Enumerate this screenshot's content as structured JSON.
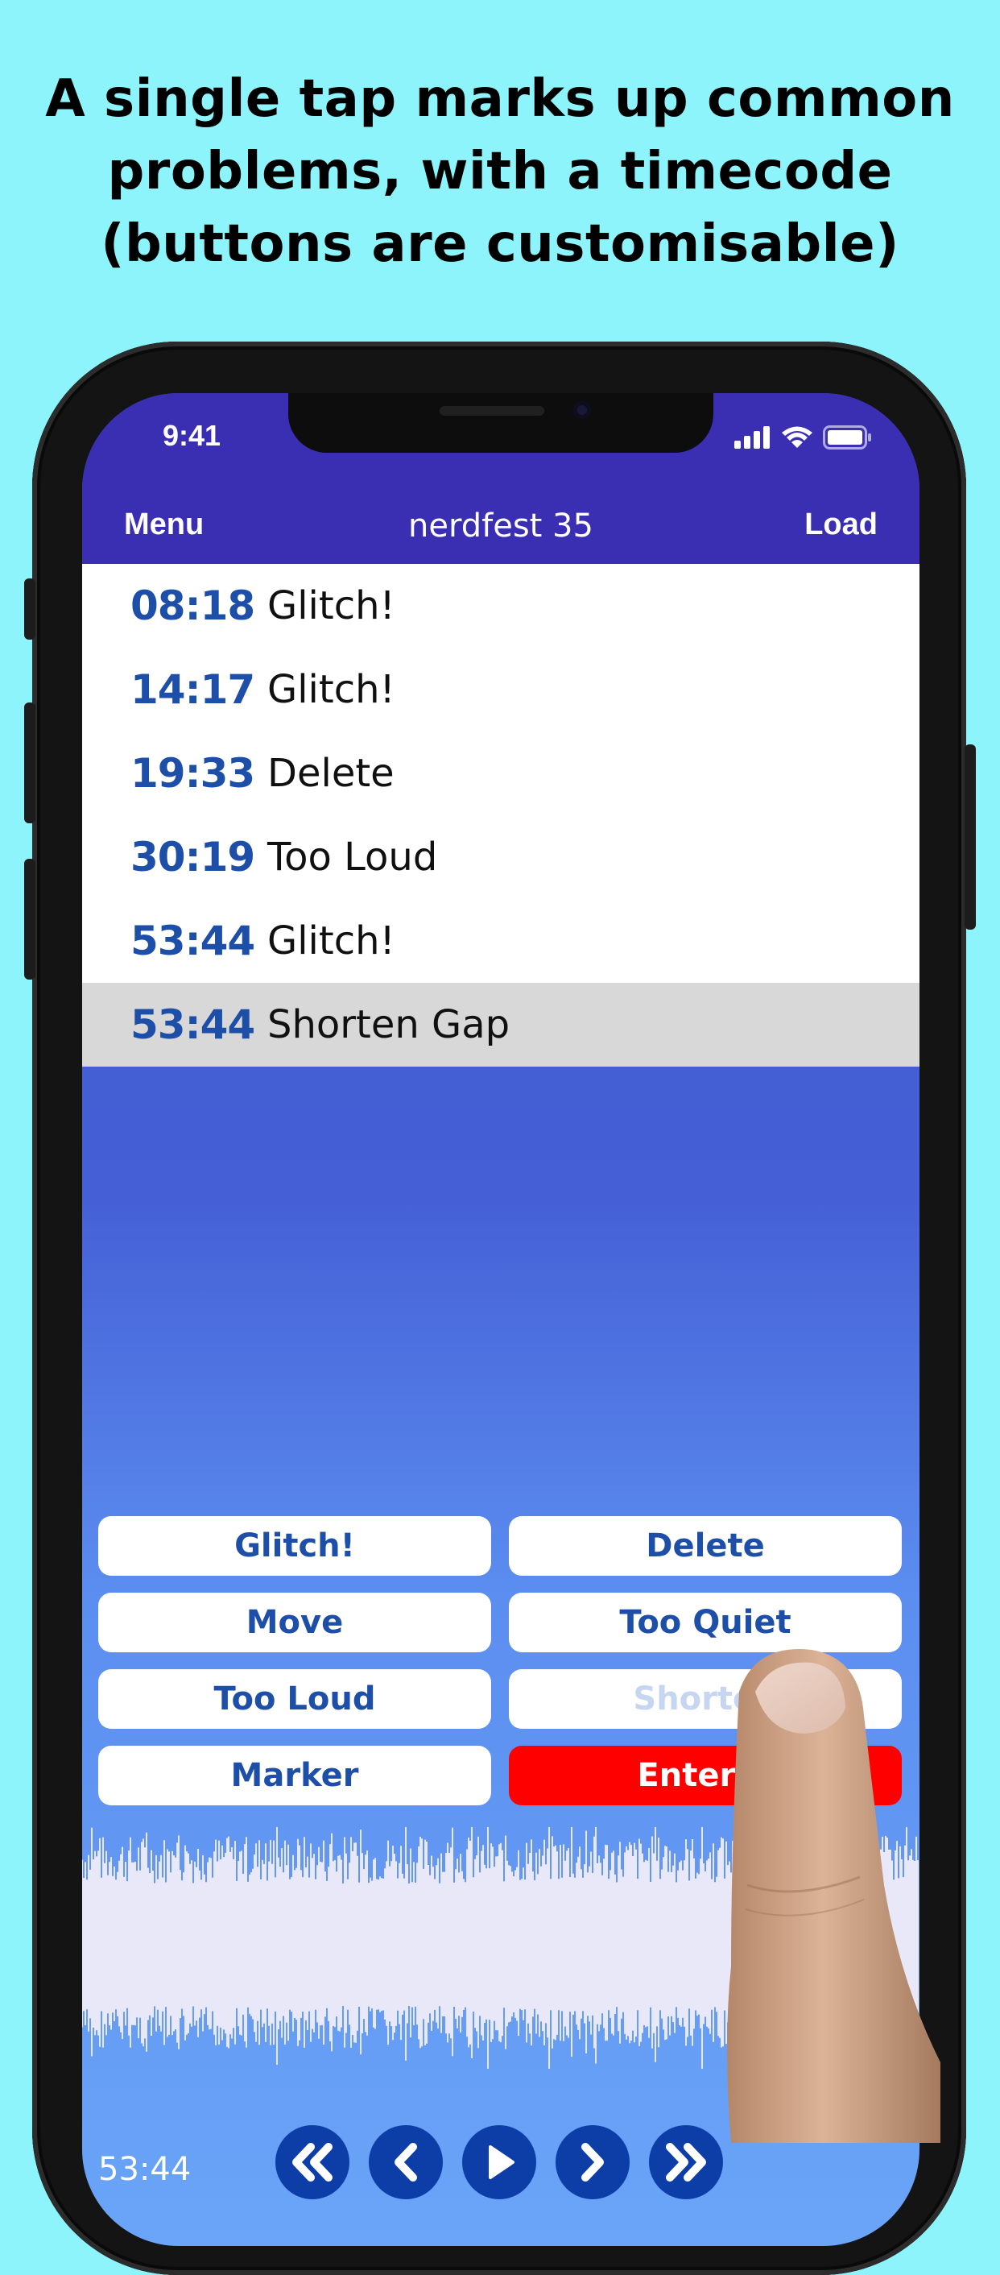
{
  "headline": {
    "line1": "A single tap marks up common",
    "line2": "problems, with a timecode",
    "line3": "(buttons are customisable)"
  },
  "status_bar": {
    "time": "9:41",
    "icons": [
      "signal-icon",
      "wifi-icon",
      "battery-icon"
    ]
  },
  "nav": {
    "left": "Menu",
    "title": "nerdfest 35",
    "right": "Load"
  },
  "markers": [
    {
      "timecode": "08:18",
      "label": "Glitch!"
    },
    {
      "timecode": "14:17",
      "label": "Glitch!"
    },
    {
      "timecode": "19:33",
      "label": "Delete"
    },
    {
      "timecode": "30:19",
      "label": "Too Loud"
    },
    {
      "timecode": "53:44",
      "label": "Glitch!"
    },
    {
      "timecode": "53:44",
      "label": "Shorten Gap",
      "selected": true
    }
  ],
  "mark_buttons": {
    "glitch": "Glitch!",
    "delete": "Delete",
    "move": "Move",
    "too_quiet": "Too Quiet",
    "too_loud": "Too Loud",
    "shorten_visible": "Shorten",
    "marker": "Marker",
    "enter_visible": "Enter N"
  },
  "playback": {
    "time": "53:44",
    "controls": [
      "skip-back-double-icon",
      "skip-back-icon",
      "play-icon",
      "skip-forward-icon",
      "skip-forward-double-icon"
    ]
  },
  "colors": {
    "background": "#8cf4fa",
    "nav_bar": "#3a2fb3",
    "accent_text": "#1d4fa8",
    "enter_button": "#ff0000",
    "transport_button": "#0d3ea8"
  }
}
